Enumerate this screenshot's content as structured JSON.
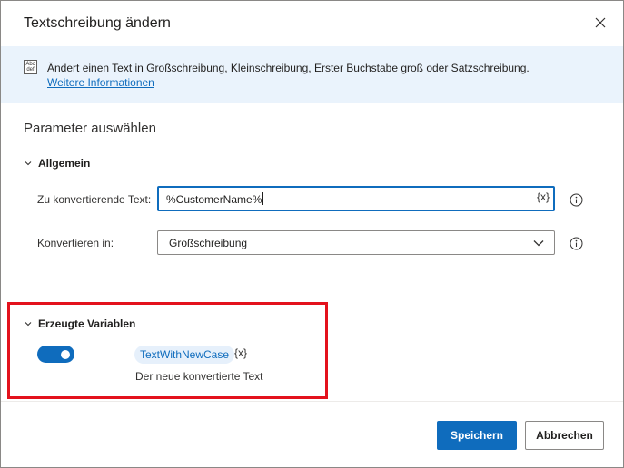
{
  "dialog": {
    "title": "Textschreibung ändern"
  },
  "info": {
    "icon_text_top": "Abc",
    "icon_text_bottom": "def",
    "text": "Ändert einen Text in Großschreibung, Kleinschreibung, Erster Buchstabe groß oder Satzschreibung.",
    "link": "Weitere Informationen"
  },
  "parameters": {
    "title": "Parameter auswählen",
    "general": {
      "header": "Allgemein",
      "text_to_convert": {
        "label": "Zu konvertierende Text:",
        "value": "%CustomerName%",
        "var_button": "{x}"
      },
      "convert_to": {
        "label": "Konvertieren in:",
        "value": "Großschreibung"
      }
    }
  },
  "variables": {
    "header": "Erzeugte Variablen",
    "toggle_on": true,
    "name": "TextWithNewCase",
    "var_button": "{x}",
    "description": "Der neue konvertierte Text"
  },
  "footer": {
    "save": "Speichern",
    "cancel": "Abbrechen"
  },
  "colors": {
    "accent": "#0f6cbd",
    "info_bg": "#eaf3fc",
    "highlight": "#e3121d"
  }
}
